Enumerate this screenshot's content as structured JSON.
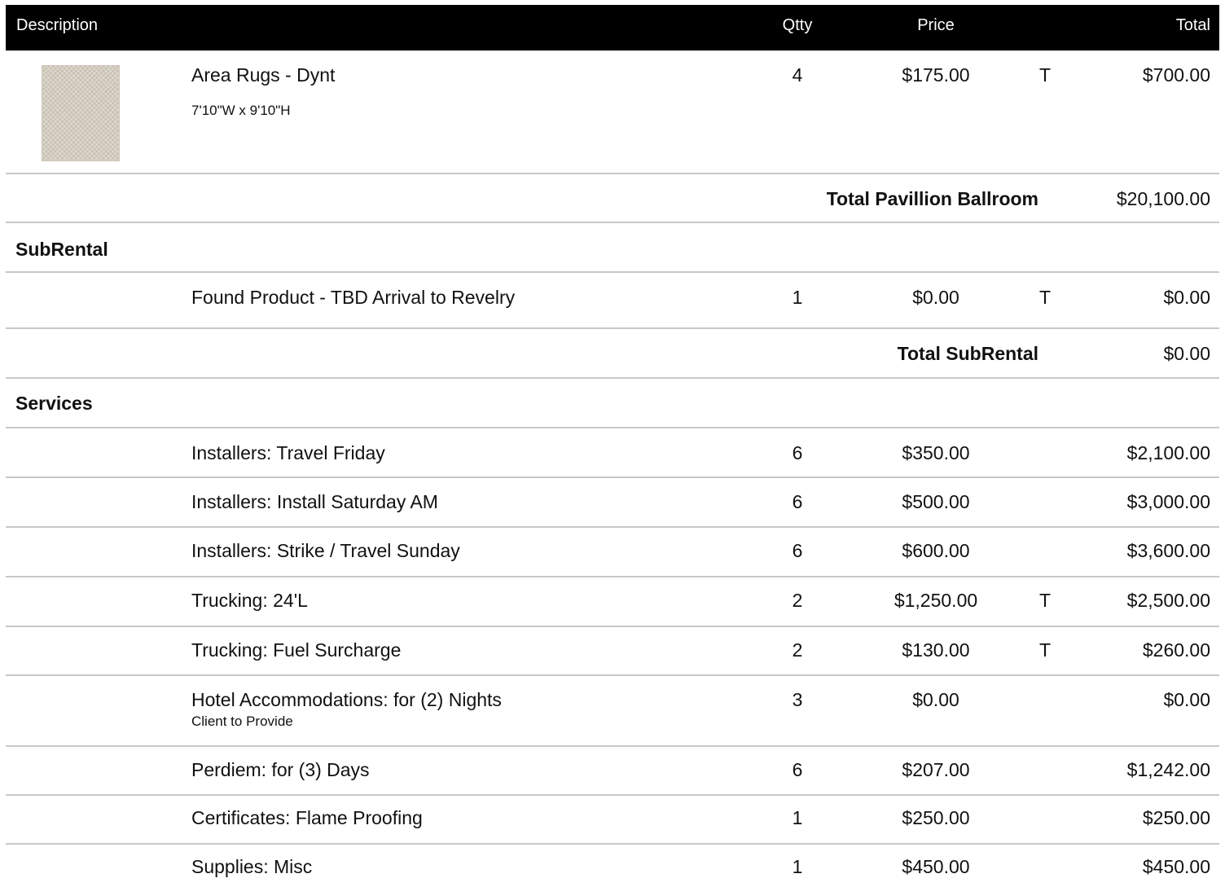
{
  "header": {
    "description": "Description",
    "qty": "Qtty",
    "price": "Price",
    "total": "Total"
  },
  "rug_item": {
    "image_icon": "area-rug-image",
    "description": "Area Rugs - Dynt",
    "dimensions": "7'10\"W x 9'10\"H",
    "qty": "4",
    "price": "$175.00",
    "tax": "T",
    "total": "$700.00"
  },
  "total_pavillion": {
    "label": "Total Pavillion Ballroom",
    "value": "$20,100.00"
  },
  "subrental": {
    "title": "SubRental",
    "items": [
      {
        "description": "Found Product - TBD Arrival to Revelry",
        "qty": "1",
        "price": "$0.00",
        "tax": "T",
        "total": "$0.00"
      }
    ],
    "total_label": "Total SubRental",
    "total_value": "$0.00"
  },
  "services": {
    "title": "Services",
    "items": [
      {
        "description": "Installers: Travel Friday",
        "qty": "6",
        "price": "$350.00",
        "tax": "",
        "total": "$2,100.00"
      },
      {
        "description": "Installers: Install Saturday AM",
        "qty": "6",
        "price": "$500.00",
        "tax": "",
        "total": "$3,000.00"
      },
      {
        "description": "Installers: Strike / Travel Sunday",
        "qty": "6",
        "price": "$600.00",
        "tax": "",
        "total": "$3,600.00"
      },
      {
        "description": "Trucking: 24'L",
        "qty": "2",
        "price": "$1,250.00",
        "tax": "T",
        "total": "$2,500.00"
      },
      {
        "description": "Trucking: Fuel Surcharge",
        "qty": "2",
        "price": "$130.00",
        "tax": "T",
        "total": "$260.00"
      },
      {
        "description": "Hotel Accommodations: for (2) Nights",
        "note": "Client to Provide",
        "qty": "3",
        "price": "$0.00",
        "tax": "",
        "total": "$0.00"
      },
      {
        "description": "Perdiem: for (3) Days",
        "qty": "6",
        "price": "$207.00",
        "tax": "",
        "total": "$1,242.00"
      },
      {
        "description": "Certificates: Flame Proofing",
        "qty": "1",
        "price": "$250.00",
        "tax": "",
        "total": "$250.00"
      },
      {
        "description": "Supplies: Misc",
        "qty": "1",
        "price": "$450.00",
        "tax": "",
        "total": "$450.00"
      }
    ]
  }
}
